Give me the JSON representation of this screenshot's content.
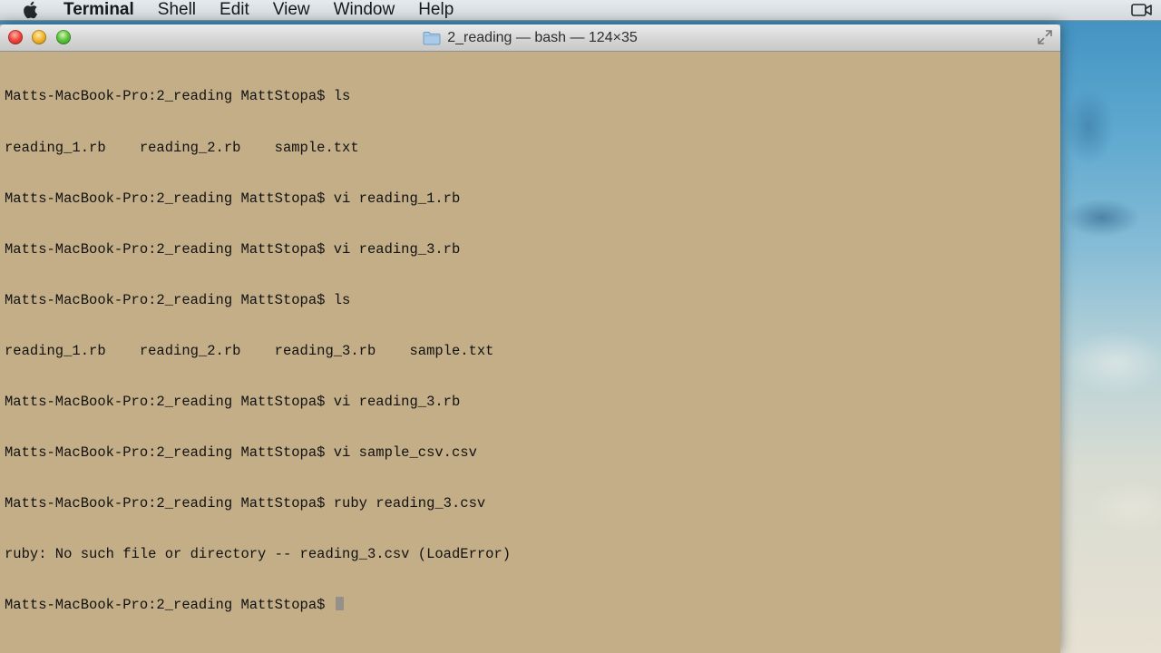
{
  "menubar": {
    "apple_icon": "apple-icon",
    "app_name": "Terminal",
    "items": [
      "Shell",
      "Edit",
      "View",
      "Window",
      "Help"
    ],
    "right_icon": "facetime-camera-icon"
  },
  "window": {
    "title": "2_reading — bash — 124×35",
    "title_icon": "folder-icon"
  },
  "terminal": {
    "lines": [
      "Matts-MacBook-Pro:2_reading MattStopa$ ls",
      "reading_1.rb    reading_2.rb    sample.txt",
      "Matts-MacBook-Pro:2_reading MattStopa$ vi reading_1.rb",
      "Matts-MacBook-Pro:2_reading MattStopa$ vi reading_3.rb",
      "Matts-MacBook-Pro:2_reading MattStopa$ ls",
      "reading_1.rb    reading_2.rb    reading_3.rb    sample.txt",
      "Matts-MacBook-Pro:2_reading MattStopa$ vi reading_3.rb",
      "Matts-MacBook-Pro:2_reading MattStopa$ vi sample_csv.csv",
      "Matts-MacBook-Pro:2_reading MattStopa$ ruby reading_3.csv",
      "ruby: No such file or directory -- reading_3.csv (LoadError)"
    ],
    "prompt": "Matts-MacBook-Pro:2_reading MattStopa$ ",
    "background_color": "#c4ae87",
    "text_color": "#111111"
  }
}
